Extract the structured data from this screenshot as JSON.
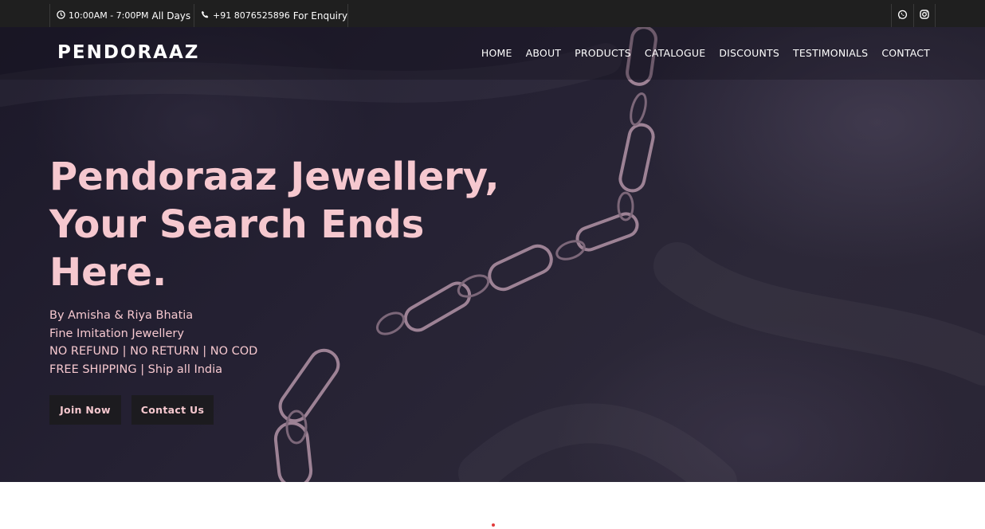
{
  "topbar": {
    "hours": "10:00AM - 7:00PM",
    "hours_suffix": "All Days",
    "phone": "+91 8076525896",
    "phone_suffix": "For Enquiry"
  },
  "brand": "PENDORAAZ",
  "nav": [
    "HOME",
    "ABOUT",
    "PRODUCTS",
    "CATALOGUE",
    "DISCOUNTS",
    "TESTIMONIALS",
    "CONTACT"
  ],
  "hero": {
    "headline": [
      "Pendoraaz Jewellery,",
      "Your Search Ends",
      "Here."
    ],
    "lines": [
      "By Amisha & Riya Bhatia",
      "Fine Imitation Jewellery",
      "NO REFUND | NO RETURN | NO COD",
      "FREE SHIPPING | Ship all India"
    ],
    "buttons": {
      "join": "Join Now",
      "contact": "Contact Us"
    }
  },
  "icons": {
    "clock": "clock-icon",
    "phone": "phone-icon",
    "whatsapp": "whatsapp-icon",
    "instagram": "instagram-icon"
  },
  "colors": {
    "accent": "#f6c8cf",
    "topbar": "#1f1f1f",
    "hero_bg": "#252133",
    "button_bg": "#1c1b1f"
  }
}
